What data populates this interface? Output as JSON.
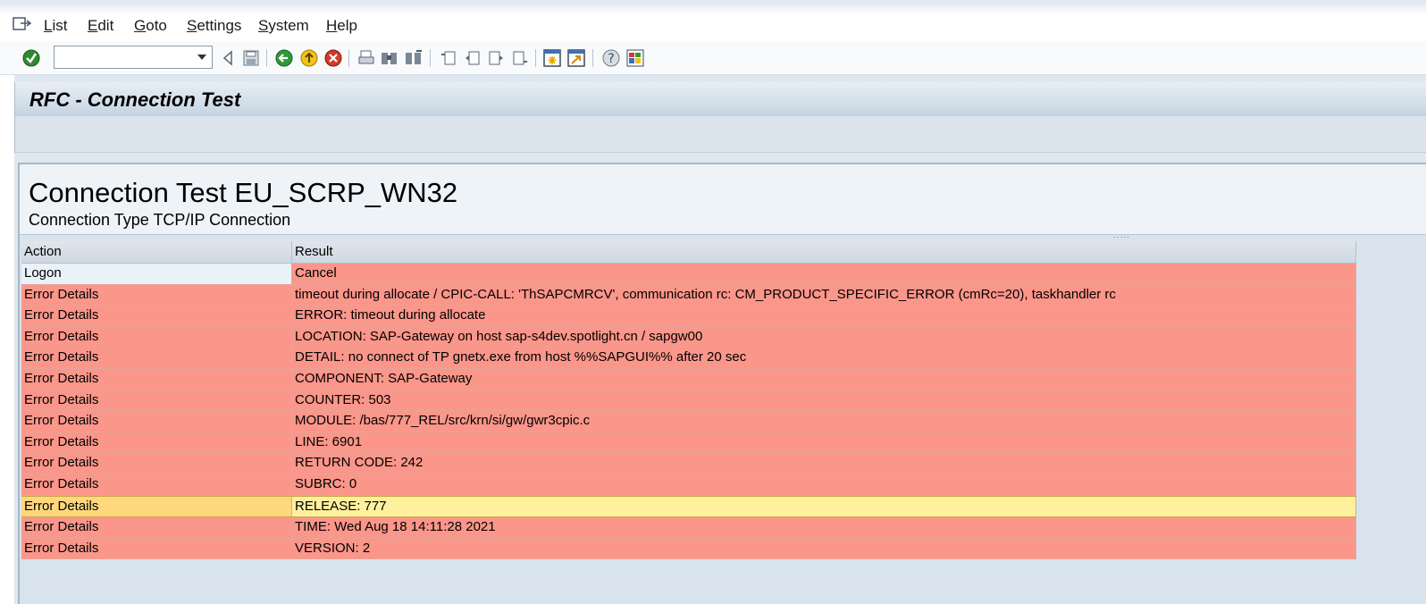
{
  "menu": {
    "items": [
      "List",
      "Edit",
      "Goto",
      "Settings",
      "System",
      "Help"
    ]
  },
  "toolbar": {
    "command_value": "",
    "icons": [
      "enter-icon",
      "back-icon",
      "save-icon",
      "back-green-icon",
      "exit-icon",
      "cancel-icon",
      "print-icon",
      "find-icon",
      "find-next-icon",
      "first-page-icon",
      "previous-page-icon",
      "next-page-icon",
      "last-page-icon",
      "create-session-icon",
      "create-shortcut-icon",
      "help-icon",
      "layout-icon"
    ]
  },
  "title": "RFC - Connection Test",
  "header": {
    "title": "Connection Test EU_SCRP_WN32",
    "subtitle": "Connection Type TCP/IP Connection",
    "splitter": "....."
  },
  "table": {
    "columns": [
      "Action",
      "Result"
    ],
    "rows": [
      {
        "action": "Logon",
        "result": "Cancel",
        "status": "logon"
      },
      {
        "action": "Error Details",
        "result": "timeout during allocate / CPIC-CALL: 'ThSAPCMRCV', communication rc: CM_PRODUCT_SPECIFIC_ERROR (cmRc=20), taskhandler rc",
        "status": "err"
      },
      {
        "action": "Error Details",
        "result": "ERROR: timeout during allocate",
        "status": "err"
      },
      {
        "action": "Error Details",
        "result": "LOCATION: SAP-Gateway on host sap-s4dev.spotlight.cn / sapgw00",
        "status": "err"
      },
      {
        "action": "Error Details",
        "result": "DETAIL: no connect of TP gnetx.exe from host %%SAPGUI%% after 20 sec",
        "status": "err"
      },
      {
        "action": "Error Details",
        "result": "COMPONENT: SAP-Gateway",
        "status": "err"
      },
      {
        "action": "Error Details",
        "result": "COUNTER: 503",
        "status": "err"
      },
      {
        "action": "Error Details",
        "result": "MODULE: /bas/777_REL/src/krn/si/gw/gwr3cpic.c",
        "status": "err"
      },
      {
        "action": "Error Details",
        "result": "LINE: 6901",
        "status": "err"
      },
      {
        "action": "Error Details",
        "result": "RETURN CODE: 242",
        "status": "err"
      },
      {
        "action": "Error Details",
        "result": "SUBRC: 0",
        "status": "err"
      },
      {
        "action": "Error Details",
        "result": "RELEASE: 777",
        "status": "warn"
      },
      {
        "action": "Error Details",
        "result": "TIME: Wed Aug 18 14:11:28 2021",
        "status": "err"
      },
      {
        "action": "Error Details",
        "result": "VERSION: 2",
        "status": "err"
      }
    ]
  }
}
